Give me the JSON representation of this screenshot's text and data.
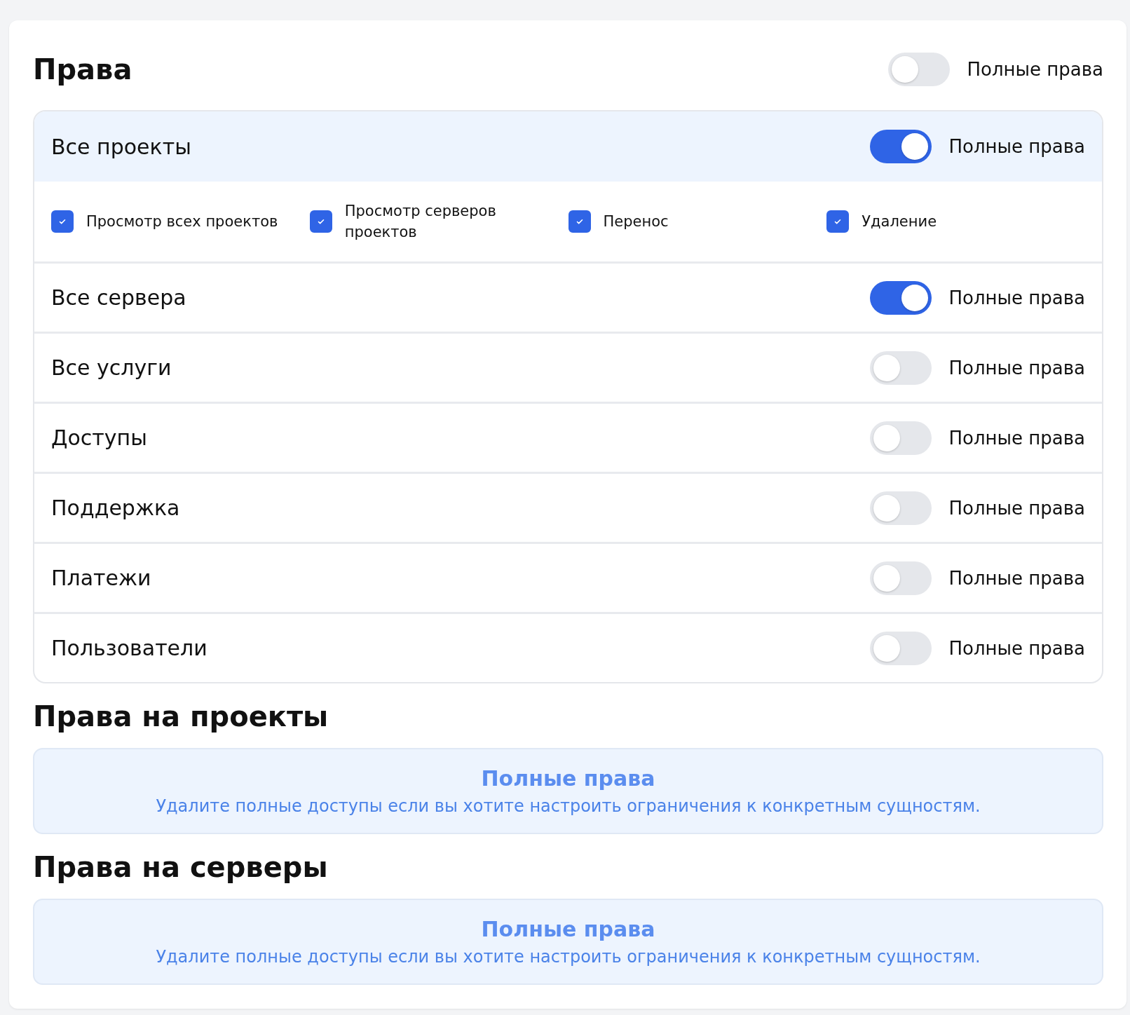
{
  "title": "Права",
  "full_access": {
    "label": "Полные права",
    "on": false
  },
  "sections": [
    {
      "name": "Все проекты",
      "toggle_label": "Полные права",
      "on": true,
      "expanded": true,
      "permissions": [
        {
          "label": "Просмотр всех проектов",
          "checked": true
        },
        {
          "label": "Просмотр серверов проектов",
          "checked": true
        },
        {
          "label": "Перенос",
          "checked": true
        },
        {
          "label": "Удаление",
          "checked": true
        }
      ]
    },
    {
      "name": "Все сервера",
      "toggle_label": "Полные права",
      "on": true,
      "expanded": false
    },
    {
      "name": "Все услуги",
      "toggle_label": "Полные права",
      "on": false,
      "expanded": false
    },
    {
      "name": "Доступы",
      "toggle_label": "Полные права",
      "on": false,
      "expanded": false
    },
    {
      "name": "Поддержка",
      "toggle_label": "Полные права",
      "on": false,
      "expanded": false
    },
    {
      "name": "Платежи",
      "toggle_label": "Полные права",
      "on": false,
      "expanded": false
    },
    {
      "name": "Пользователи",
      "toggle_label": "Полные права",
      "on": false,
      "expanded": false
    }
  ],
  "subsections": [
    {
      "title": "Права на проекты",
      "notice": {
        "title": "Полные права",
        "text": "Удалите полные доступы если вы хотите настроить ограничения к конкретным сущностям."
      }
    },
    {
      "title": "Права на серверы",
      "notice": {
        "title": "Полные права",
        "text": "Удалите полные доступы если вы хотите настроить ограничения к конкретным сущностям."
      }
    }
  ]
}
